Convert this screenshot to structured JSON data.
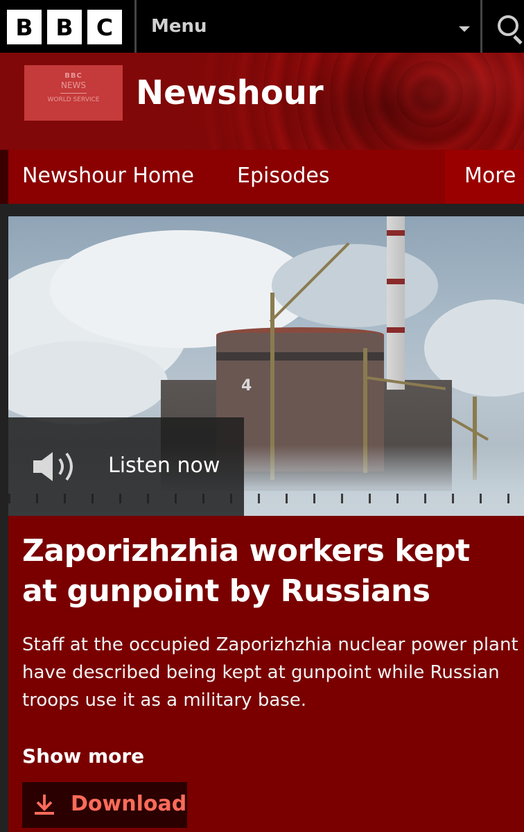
{
  "topbar": {
    "logo_letters": [
      "B",
      "B",
      "C"
    ],
    "menu_label": "Menu",
    "icons": {
      "menu": "chevron-down-icon",
      "search": "search-icon"
    }
  },
  "brand": {
    "logo_line1": "BBC",
    "logo_line2": "NEWS",
    "logo_line3": "WORLD SERVICE",
    "title": "Newshour"
  },
  "nav": {
    "items": [
      {
        "label": "Newshour Home"
      },
      {
        "label": "Episodes"
      }
    ],
    "more_label": "More"
  },
  "hero": {
    "image_description_number": "4",
    "listen_label": "Listen now",
    "listen_icon": "speaker-icon"
  },
  "article": {
    "headline": "Zaporizhzhia workers kept at gunpoint by Russians",
    "summary": "Staff at the occupied Zaporizhzhia nuclear power plant have described being kept at gunpoint while Russian troops use it as a military base.",
    "show_more_label": "Show more",
    "download_label": "Download",
    "download_icon": "download-icon"
  },
  "colors": {
    "brand_red": "#800808",
    "card_red": "#7a0000",
    "nav_red": "#8b0000",
    "download_accent": "#ff6b5a",
    "top_bar": "#000000"
  }
}
